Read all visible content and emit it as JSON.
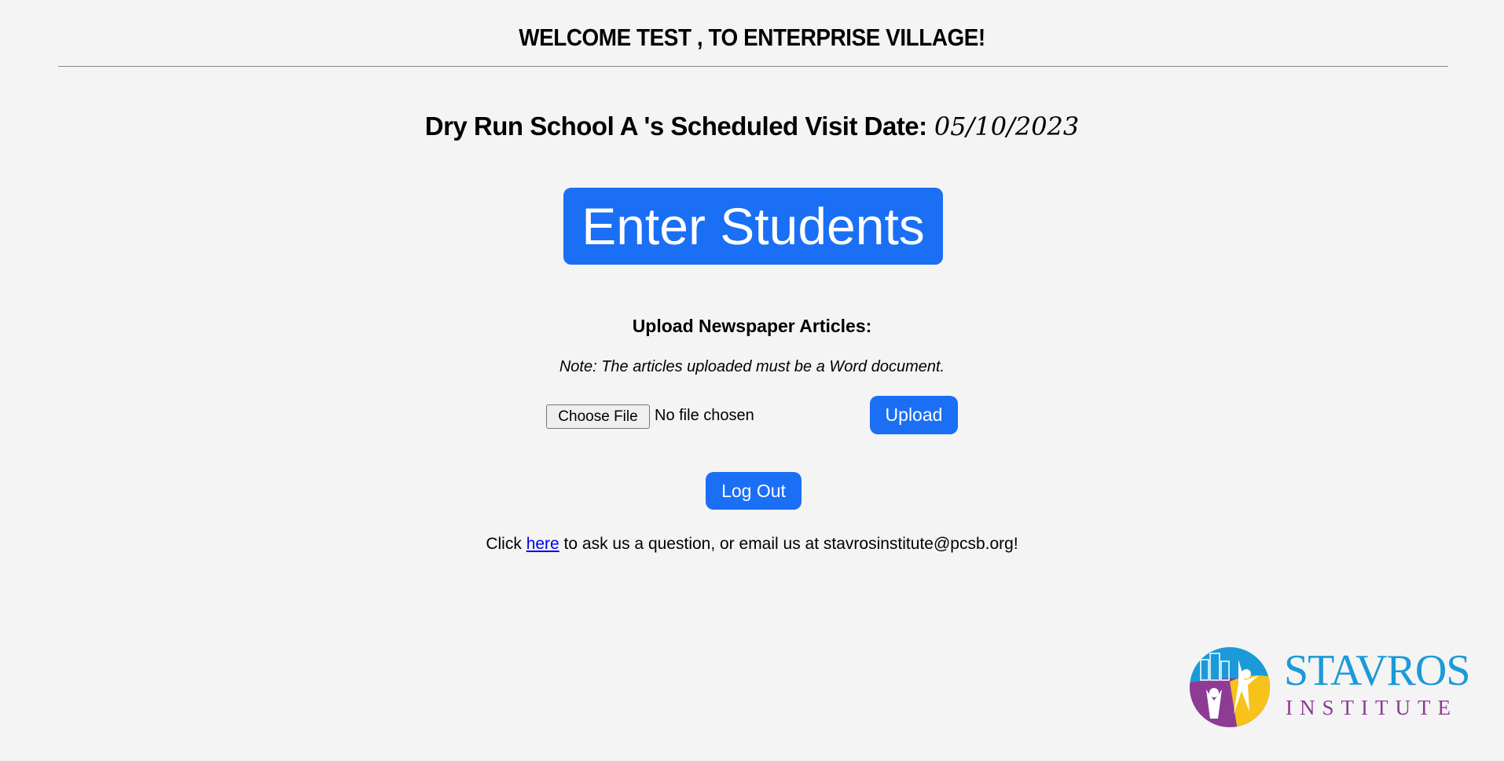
{
  "header": {
    "title": "WELCOME TEST , TO ENTERPRISE VILLAGE!"
  },
  "visit": {
    "label": "Dry Run School A 's Scheduled Visit Date:",
    "date": "05/10/2023"
  },
  "enter_students_label": "Enter Students",
  "upload": {
    "heading": "Upload Newspaper Articles:",
    "note": "Note: The articles uploaded must be a Word document.",
    "choose_file_label": "Choose File",
    "file_status": "No file chosen",
    "upload_label": "Upload"
  },
  "logout_label": "Log Out",
  "footer": {
    "prefix": "Click ",
    "link": "here",
    "suffix": " to ask us a question, or email us at stavrosinstitute@pcsb.org!"
  },
  "logo": {
    "name": "STAVROS",
    "sub": "INSTITUTE"
  },
  "colors": {
    "accent": "#1a6ff5",
    "background": "#f4f4f4",
    "logo_blue": "#1a9ad8",
    "logo_purple": "#8e3b96",
    "logo_yellow": "#f7c21a"
  }
}
